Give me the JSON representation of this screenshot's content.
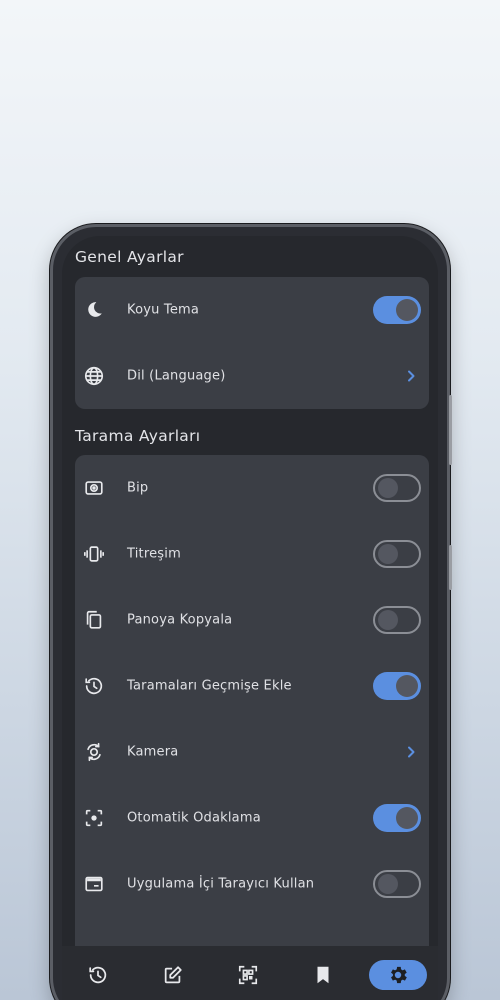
{
  "sections": [
    {
      "title": "Genel Ayarlar",
      "items": [
        {
          "icon": "moon-icon",
          "label": "Koyu Tema",
          "control": "toggle",
          "on": true
        },
        {
          "icon": "globe-icon",
          "label": "Dil (Language)",
          "control": "chevron"
        }
      ]
    },
    {
      "title": "Tarama Ayarları",
      "items": [
        {
          "icon": "speaker-icon",
          "label": "Bip",
          "control": "toggle",
          "on": false
        },
        {
          "icon": "vibration-icon",
          "label": "Titreşim",
          "control": "toggle",
          "on": false
        },
        {
          "icon": "copy-icon",
          "label": "Panoya Kopyala",
          "control": "toggle",
          "on": false
        },
        {
          "icon": "history-icon",
          "label": "Taramaları Geçmişe Ekle",
          "control": "toggle",
          "on": true
        },
        {
          "icon": "camera-switch-icon",
          "label": "Kamera",
          "control": "chevron"
        },
        {
          "icon": "focus-icon",
          "label": "Otomatik Odaklama",
          "control": "toggle",
          "on": true
        },
        {
          "icon": "browser-icon",
          "label": "Uygulama İçi Tarayıcı Kullan",
          "control": "toggle",
          "on": false
        }
      ]
    }
  ],
  "bottom_nav": [
    {
      "icon": "history-icon",
      "active": false
    },
    {
      "icon": "edit-icon",
      "active": false
    },
    {
      "icon": "qr-scan-icon",
      "active": false
    },
    {
      "icon": "bookmark-icon",
      "active": false
    },
    {
      "icon": "gear-icon",
      "active": true
    }
  ],
  "colors": {
    "accent": "#5b8fe0",
    "card": "#3b3e45",
    "screen": "#26282d",
    "text": "#e0e1e5"
  }
}
